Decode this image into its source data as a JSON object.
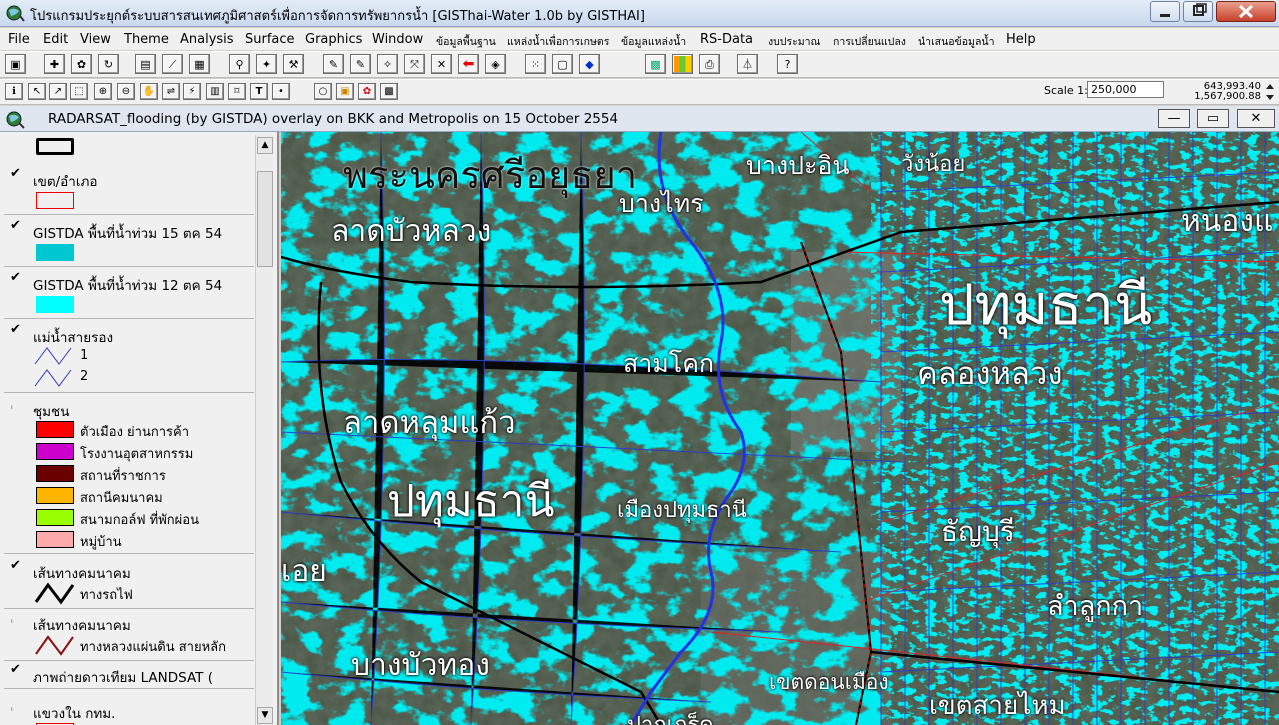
{
  "window": {
    "title": "โปรแกรมประยุกต์ระบบสารสนเทศภูมิศาสตร์เพื่อการจัดการทรัพยากรน้ำ  [GISThai-Water 1.0b   by GISTHAI]"
  },
  "menu": [
    "File",
    "Edit",
    "View",
    "Theme",
    "Analysis",
    "Surface",
    "Graphics",
    "Window",
    "ข้อมูลพื้นฐาน",
    "แหล่งน้ำเพื่อการเกษตร",
    "ข้อมูลแหล่งน้ำ",
    "RS-Data",
    "งบประมาณ",
    "การเปลี่ยนแปลง",
    "นำเสนอข้อมูลน้ำ",
    "Help"
  ],
  "toolbar": {
    "scale_label": "Scale 1:",
    "scale_value": "250,000",
    "coord_x": "643,993.40",
    "coord_y": "1,567,900.88"
  },
  "document": {
    "title": "RADARSAT_flooding (by GISTDA) overlay on BKK and Metropolis on 15 October 2554"
  },
  "legend": {
    "themes": [
      {
        "label": "เขต/อำเภอ",
        "checked": true
      },
      {
        "label": "GISTDA พื้นที่น้ำท่วม 15 ตค 54",
        "checked": true,
        "color": "#00c8d2"
      },
      {
        "label": "GISTDA พื้นที่น้ำท่วม 12 ตค 54",
        "checked": true,
        "color": "#00ffff"
      },
      {
        "label": "แม่น้ำสายรอง",
        "checked": true,
        "classes": [
          "1",
          "2"
        ]
      },
      {
        "label": "ชุมชน",
        "checked": false
      },
      {
        "label": "เส้นทางคมนาคม",
        "checked": true,
        "sub": "ทางรถไฟ"
      },
      {
        "label": "เส้นทางคมนาคม",
        "checked": false,
        "sub": "ทางหลวงแผ่นดิน สายหลัก"
      },
      {
        "label": "ภาพถ่ายดาวเทียม LANDSAT  (",
        "checked": true
      },
      {
        "label": "แขวงใน กทม.",
        "checked": false
      }
    ],
    "community_classes": [
      {
        "label": "ตัวเมือง ย่านการค้า",
        "color": "#ff0000"
      },
      {
        "label": "โรงงานอุตสาหกรรม",
        "color": "#cc00cc"
      },
      {
        "label": "สถานที่ราชการ",
        "color": "#6b0000"
      },
      {
        "label": "สถานีคมนาคม",
        "color": "#ffb400"
      },
      {
        "label": "สนามกอล์ฟ ที่พักผ่อน",
        "color": "#99ff00"
      },
      {
        "label": "หมู่บ้าน",
        "color": "#ffaaaa"
      }
    ]
  },
  "map": {
    "labels": [
      {
        "text": "พระนครศรีอยุธยา",
        "kind": "province"
      },
      {
        "text": "บางปะอิน",
        "kind": "district"
      },
      {
        "text": "วังน้อย",
        "kind": "district"
      },
      {
        "text": "บางไทร",
        "kind": "district"
      },
      {
        "text": "ลาดบัวหลวง",
        "kind": "district"
      },
      {
        "text": "หนองแ",
        "kind": "district"
      },
      {
        "text": "ปทุมธานี",
        "kind": "province"
      },
      {
        "text": "สามโคก",
        "kind": "district"
      },
      {
        "text": "คลองหลวง",
        "kind": "district"
      },
      {
        "text": "ลาดหลุมแก้ว",
        "kind": "district"
      },
      {
        "text": "ปทุมธานี",
        "kind": "province"
      },
      {
        "text": "เมืองปทุมธานี",
        "kind": "district"
      },
      {
        "text": "ธัญบุรี",
        "kind": "district"
      },
      {
        "text": "เอย",
        "kind": "district"
      },
      {
        "text": "ลำลูกกา",
        "kind": "district"
      },
      {
        "text": "บางบัวทอง",
        "kind": "district"
      },
      {
        "text": "เขตดอนเมือง",
        "kind": "district"
      },
      {
        "text": "เขตสายไหม",
        "kind": "district"
      },
      {
        "text": "ปากเกร็ด",
        "kind": "district"
      }
    ]
  }
}
